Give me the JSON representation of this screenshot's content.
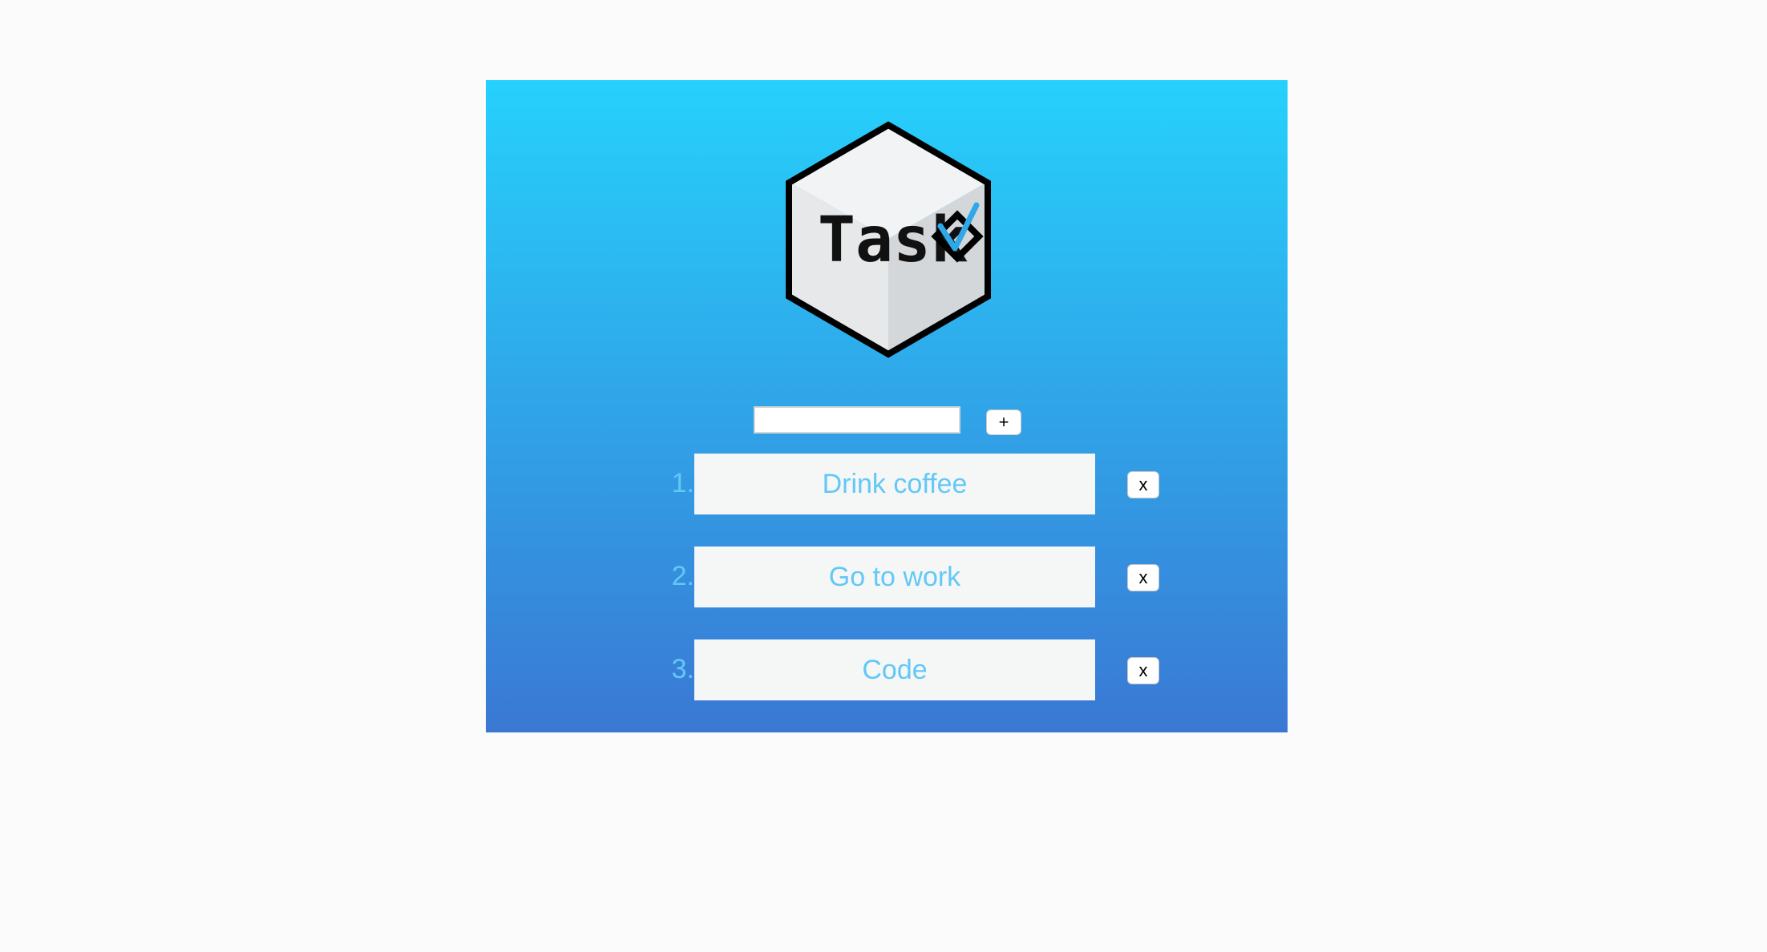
{
  "app": {
    "logo_text": "Task"
  },
  "add_task": {
    "input_value": "",
    "add_label": "+"
  },
  "tasks": [
    {
      "number": "1.",
      "text": "Drink coffee",
      "delete_label": "x"
    },
    {
      "number": "2.",
      "text": "Go to work",
      "delete_label": "x"
    },
    {
      "number": "3.",
      "text": "Code",
      "delete_label": "x"
    }
  ],
  "colors": {
    "gradient_top": "#26d1fc",
    "gradient_bottom": "#3a78d4",
    "task_text": "#63c8f6",
    "task_background": "#f5f7f6",
    "check_accent": "#2ea8e8"
  },
  "icons": {
    "logo": "hexagon-cube-check-logo"
  }
}
